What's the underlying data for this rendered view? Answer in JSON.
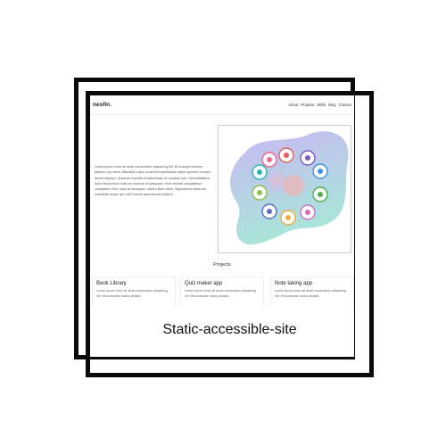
{
  "site": {
    "brand": "nesfin.",
    "nav": [
      "About",
      "Projects",
      "Skills",
      "Blog",
      "Contact"
    ],
    "hero_text": "Lorem ipsum dolor sit amet consectetur adipiscing elit. Mi suscipit maxime pariatur quo amet. Blanditiis culpa commodi repellendus atque aperiam cumque facere adipisci. Quaerat expedita et laboriosam et voluptas iure. Necessitatibus dolor temporibus nostrum maxime id quisquam. Sunt veniam voluptatibus voluptatem nihil, dolor at numquam, autem illum nobis, dignissimos deserunt cupiditate neque quo velit cursus assumenda incidunt.",
    "projects_title": "Projects",
    "projects": [
      {
        "title": "Book Library",
        "desc": "Lorem ipsum dolor sit amet consectetur adipiscing elit. Recusandae natus pariatur."
      },
      {
        "title": "Quiz maker app",
        "desc": "Lorem ipsum dolor sit amet consectetur adipiscing elit. Recusandae natus pariatur."
      },
      {
        "title": "Note taking app",
        "desc": "Lorem ipsum dolor sit amet consectetur adipiscing elit. Recusandae natus pariatur."
      }
    ]
  },
  "caption": "Static-accessible-site",
  "colors": {
    "frame": "#0b0b0b",
    "blob_top": "#c9b8f5",
    "blob_bottom": "#a8e6d8",
    "icon_colors": [
      "#e85d5d",
      "#f0a840",
      "#4bb04f",
      "#7e57c2",
      "#3f8fe0",
      "#d46cc8",
      "#2bb4b4",
      "#f06292",
      "#5c6bc0",
      "#8bc34a",
      "#ff8a65",
      "#26a69a"
    ]
  }
}
